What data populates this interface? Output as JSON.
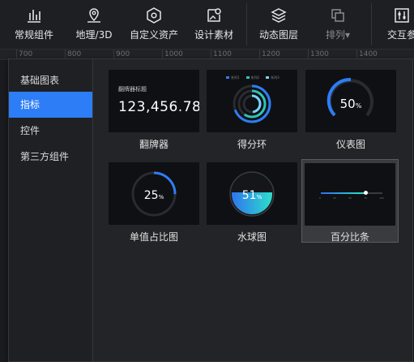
{
  "toolbar": {
    "items": [
      {
        "label": "常规组件",
        "icon": "bar-chart-icon"
      },
      {
        "label": "地理/3D",
        "icon": "map-pin-icon"
      },
      {
        "label": "自定义资产",
        "icon": "hexagon-icon"
      },
      {
        "label": "设计素材",
        "icon": "image-pin-icon"
      },
      {
        "label": "动态图层",
        "icon": "layers-icon"
      },
      {
        "label": "排列▾",
        "icon": "arrange-icon"
      },
      {
        "label": "交互参",
        "icon": "sliders-icon"
      }
    ]
  },
  "ruler": {
    "labels": [
      "700",
      "800",
      "900",
      "1000",
      "1100",
      "1200",
      "1300",
      "1400"
    ]
  },
  "sidebar": {
    "items": [
      {
        "label": "基础图表"
      },
      {
        "label": "指标"
      },
      {
        "label": "控件"
      },
      {
        "label": "第三方组件"
      }
    ]
  },
  "cards": [
    {
      "label": "翻牌器",
      "title": "翻牌器标题",
      "value": "123,456.78"
    },
    {
      "label": "得分环",
      "legend": [
        "系列1",
        "系列2",
        "系列3"
      ]
    },
    {
      "label": "仪表图",
      "value": "50",
      "unit": "%"
    },
    {
      "label": "单值占比图",
      "value": "25",
      "unit": "%"
    },
    {
      "label": "水球图",
      "value": "51",
      "unit": "%"
    },
    {
      "label": "百分比条",
      "ticks": [
        "0",
        "25",
        "50",
        "75",
        "100"
      ]
    }
  ],
  "colors": {
    "accent": "#2d7df6",
    "gradient_start": "#2f6df0",
    "gradient_end": "#2ee6c8"
  }
}
